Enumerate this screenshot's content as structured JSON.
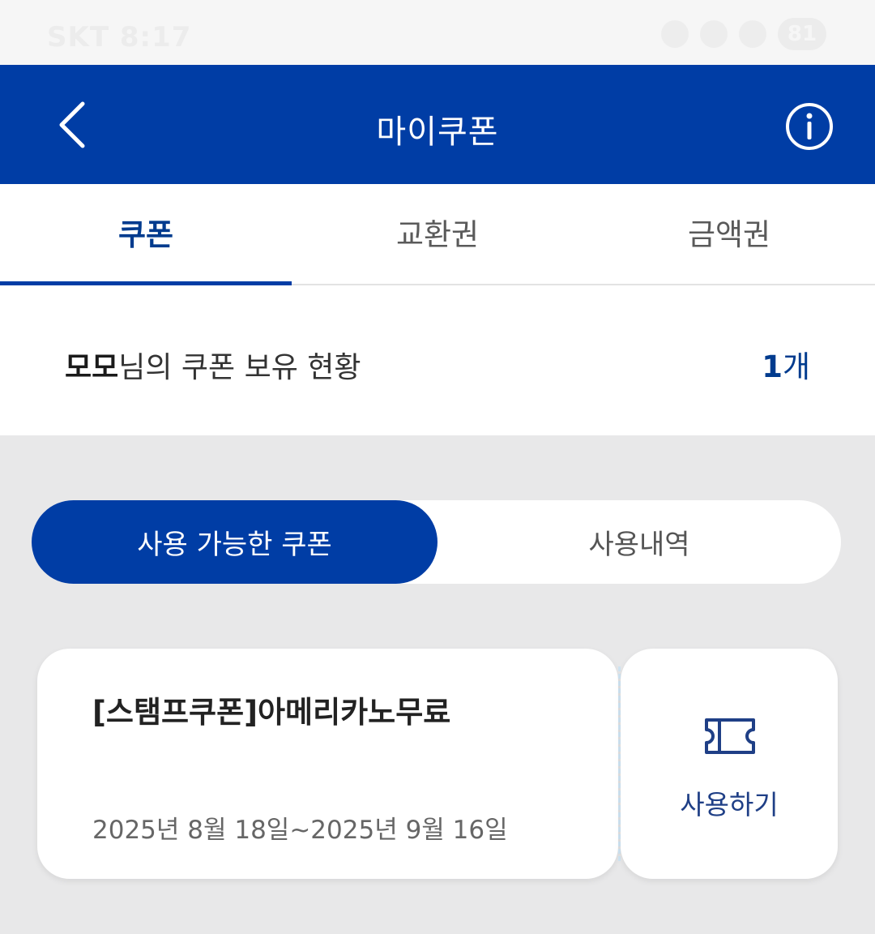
{
  "status_bar": {
    "carrier_time": "SKT 8:17",
    "battery": "81"
  },
  "header": {
    "title": "마이쿠폰",
    "back_icon": "chevron-left-icon",
    "info_icon": "info-circle-icon"
  },
  "tabs": [
    {
      "label": "쿠폰",
      "active": true
    },
    {
      "label": "교환권",
      "active": false
    },
    {
      "label": "금액권",
      "active": false
    }
  ],
  "summary": {
    "name": "모모",
    "label_suffix": "님의 쿠폰 보유 현황",
    "count": "1",
    "count_unit": "개"
  },
  "segment": {
    "available": "사용 가능한 쿠폰",
    "history": "사용내역"
  },
  "coupons": [
    {
      "title": "[스탬프쿠폰]아메리카노무료",
      "period": "2025년 8월 18일~2025년 9월 16일",
      "use_label": "사용하기",
      "icon": "ticket-icon"
    }
  ],
  "colors": {
    "primary": "#003da5",
    "background": "#e8e8e9",
    "accent_text": "#003b8e"
  }
}
